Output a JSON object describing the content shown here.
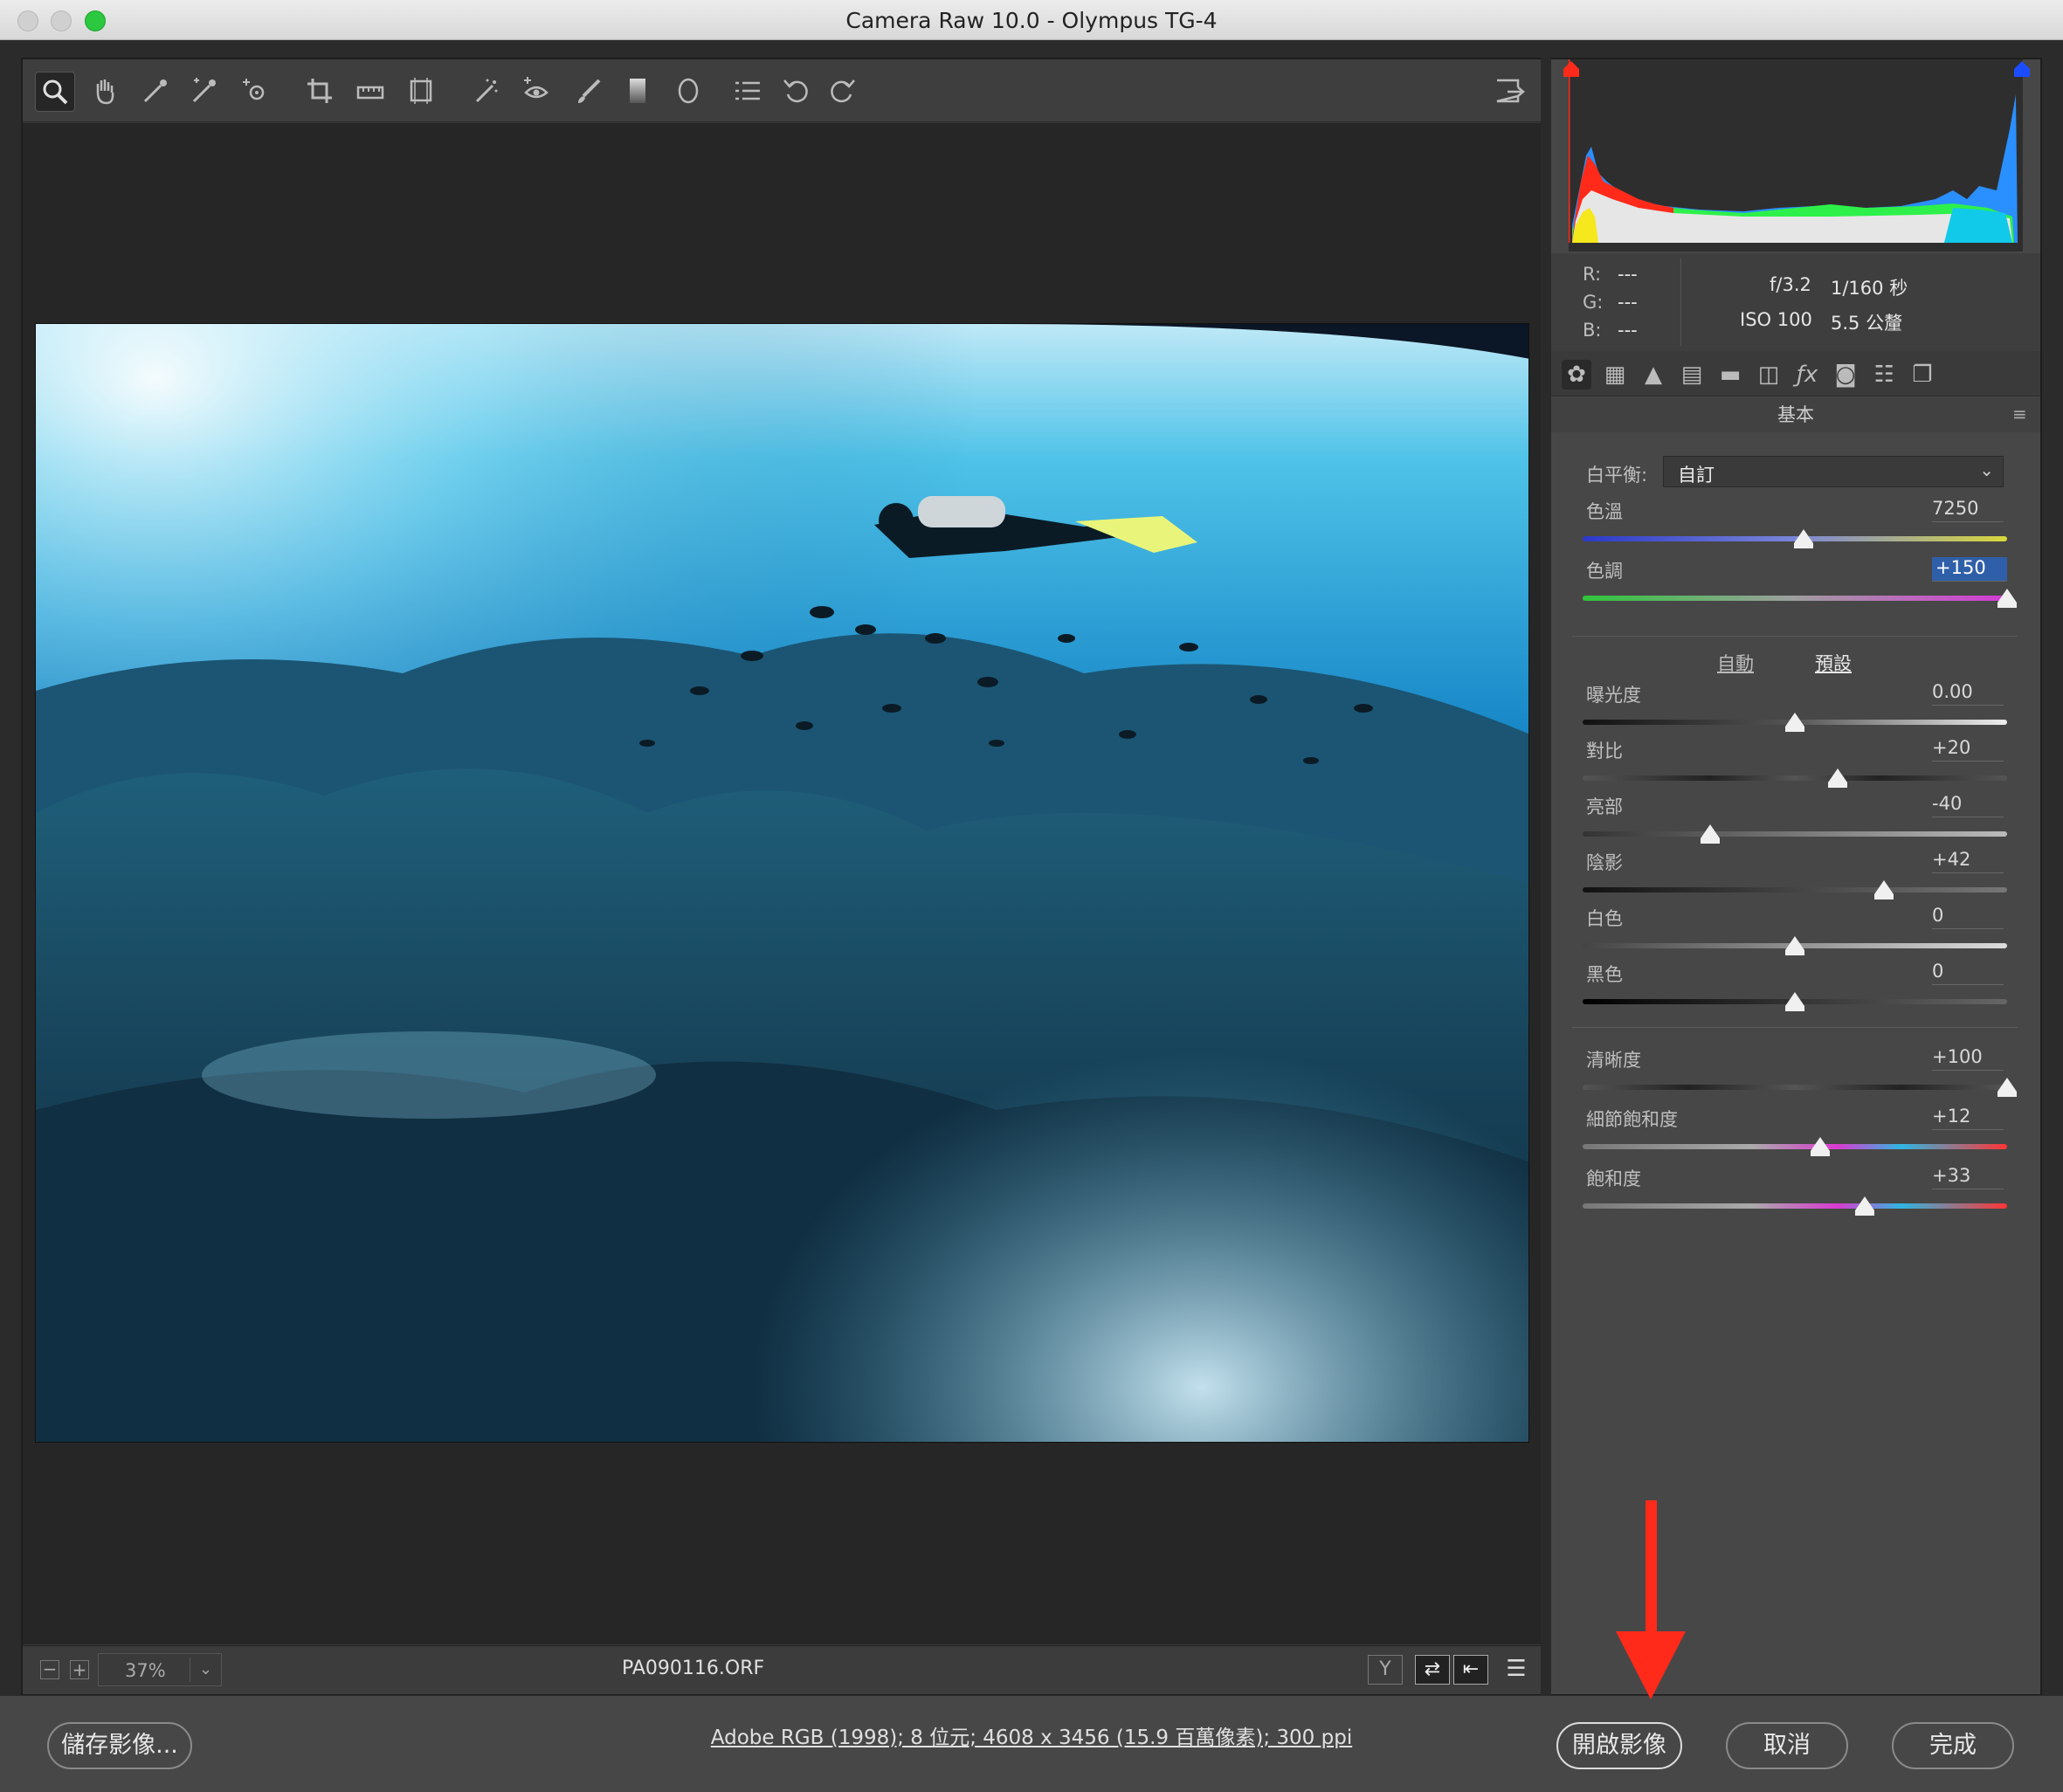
{
  "window": {
    "title": "Camera Raw 10.0  -  Olympus TG-4"
  },
  "toolbar": {
    "tools": [
      "zoom-icon",
      "hand-icon",
      "white-balance-icon",
      "color-sampler-icon",
      "targeted-adjustment-icon",
      "crop-icon",
      "straighten-icon",
      "transform-icon",
      "spot-removal-icon",
      "red-eye-icon",
      "adjustment-brush-icon",
      "graduated-filter-icon",
      "radial-filter-icon",
      "presets-list-icon",
      "rotate-ccw-icon",
      "rotate-cw-icon"
    ],
    "fullscreen_icon": "fullscreen-icon"
  },
  "status": {
    "zoom": "37%",
    "filename": "PA090116.ORF"
  },
  "info": {
    "r_label": "R:",
    "r_value": "---",
    "g_label": "G:",
    "g_value": "---",
    "b_label": "B:",
    "b_value": "---",
    "aperture": "f/3.2",
    "shutter": "1/160 秒",
    "iso": "ISO 100",
    "focal": "5.5 公釐"
  },
  "panel": {
    "title": "基本",
    "wb_label": "白平衡:",
    "wb_value": "自訂",
    "auto_link": "自動",
    "default_link": "預設",
    "sliders": [
      {
        "label": "色溫",
        "value": "7250",
        "pos": 0.52
      },
      {
        "label": "色調",
        "value": "+150",
        "pos": 1.0
      },
      {
        "label": "曝光度",
        "value": "0.00",
        "pos": 0.5
      },
      {
        "label": "對比",
        "value": "+20",
        "pos": 0.6
      },
      {
        "label": "亮部",
        "value": "-40",
        "pos": 0.3
      },
      {
        "label": "陰影",
        "value": "+42",
        "pos": 0.71
      },
      {
        "label": "白色",
        "value": "0",
        "pos": 0.5
      },
      {
        "label": "黑色",
        "value": "0",
        "pos": 0.5
      },
      {
        "label": "清晰度",
        "value": "+100",
        "pos": 1.0
      },
      {
        "label": "細節飽和度",
        "value": "+12",
        "pos": 0.56
      },
      {
        "label": "飽和度",
        "value": "+33",
        "pos": 0.665
      }
    ]
  },
  "bottom": {
    "save_label": "儲存影像...",
    "workflow": "Adobe RGB (1998); 8 位元; 4608 x 3456 (15.9 百萬像素); 300 ppi",
    "open_label": "開啟影像",
    "cancel_label": "取消",
    "done_label": "完成"
  },
  "colors": {
    "accent_red": "#ff2a1a",
    "highlight_blue": "#2f5fa8"
  }
}
